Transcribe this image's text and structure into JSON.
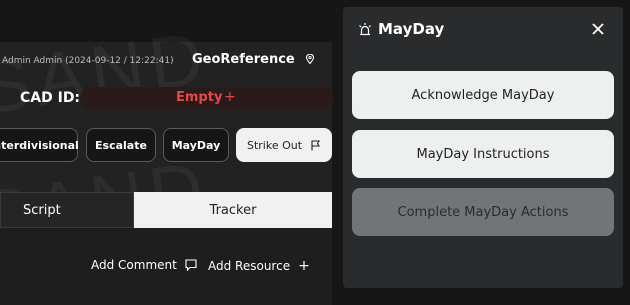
{
  "header": {
    "meta": "Admin Admin (2024-09-12 / 12:22:41)",
    "georef_label": "GeoReference"
  },
  "watermark": {
    "text": "SAND"
  },
  "cad": {
    "label": "CAD ID:",
    "value": "Empty",
    "add_symbol": "+"
  },
  "toolbar": {
    "interdivisional": "Interdivisional",
    "escalate": "Escalate",
    "mayday": "MayDay",
    "strike_out": "Strike Out"
  },
  "tabs": {
    "script": "Script",
    "tracker": "Tracker"
  },
  "actions": {
    "add_comment": "Add Comment",
    "add_resource": "Add Resource",
    "add_symbol": "+"
  },
  "modal": {
    "title": "MayDay",
    "buttons": {
      "acknowledge": "Acknowledge MayDay",
      "instructions": "MayDay Instructions",
      "complete": "Complete MayDay Actions"
    }
  },
  "colors": {
    "accent_red": "#e54848",
    "modal_bg": "#2a2b2c",
    "light_btn": "#eef0f0",
    "disabled_btn": "#727577"
  },
  "icons": {
    "georef": "map-pin-icon",
    "strike": "flag-icon",
    "comment": "comment-icon",
    "alarm": "alarm-light-icon",
    "close": "close-icon"
  }
}
